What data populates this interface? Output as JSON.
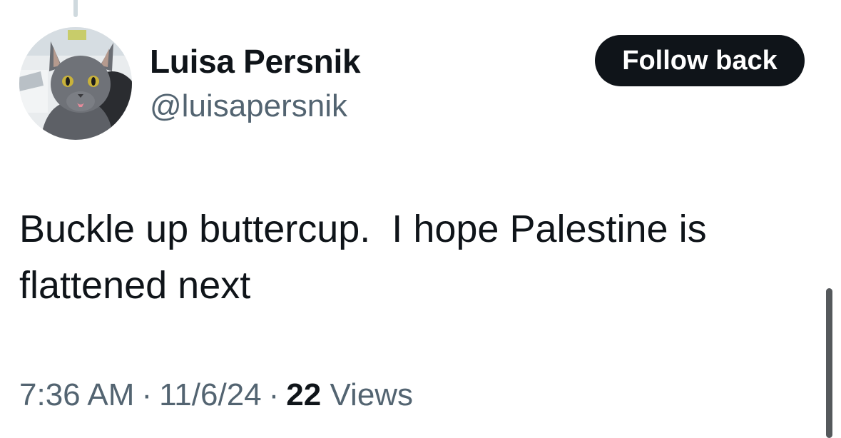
{
  "user": {
    "display_name": "Luisa Persnik",
    "handle": "@luisapersnik",
    "avatar_icon": "cat-photo-avatar"
  },
  "actions": {
    "follow_label": "Follow back"
  },
  "tweet": {
    "lines": [
      "Buckle up buttercup.  I hope Palestine is",
      "flattened next"
    ]
  },
  "meta": {
    "time": "7:36 AM",
    "separator": "·",
    "date": "11/6/24",
    "views_count": "22",
    "views_label": "Views"
  },
  "colors": {
    "text": "#0f1419",
    "secondary_text": "#536471",
    "button_bg": "#0f1419",
    "button_text": "#ffffff",
    "thread_line": "#cfd9de"
  }
}
